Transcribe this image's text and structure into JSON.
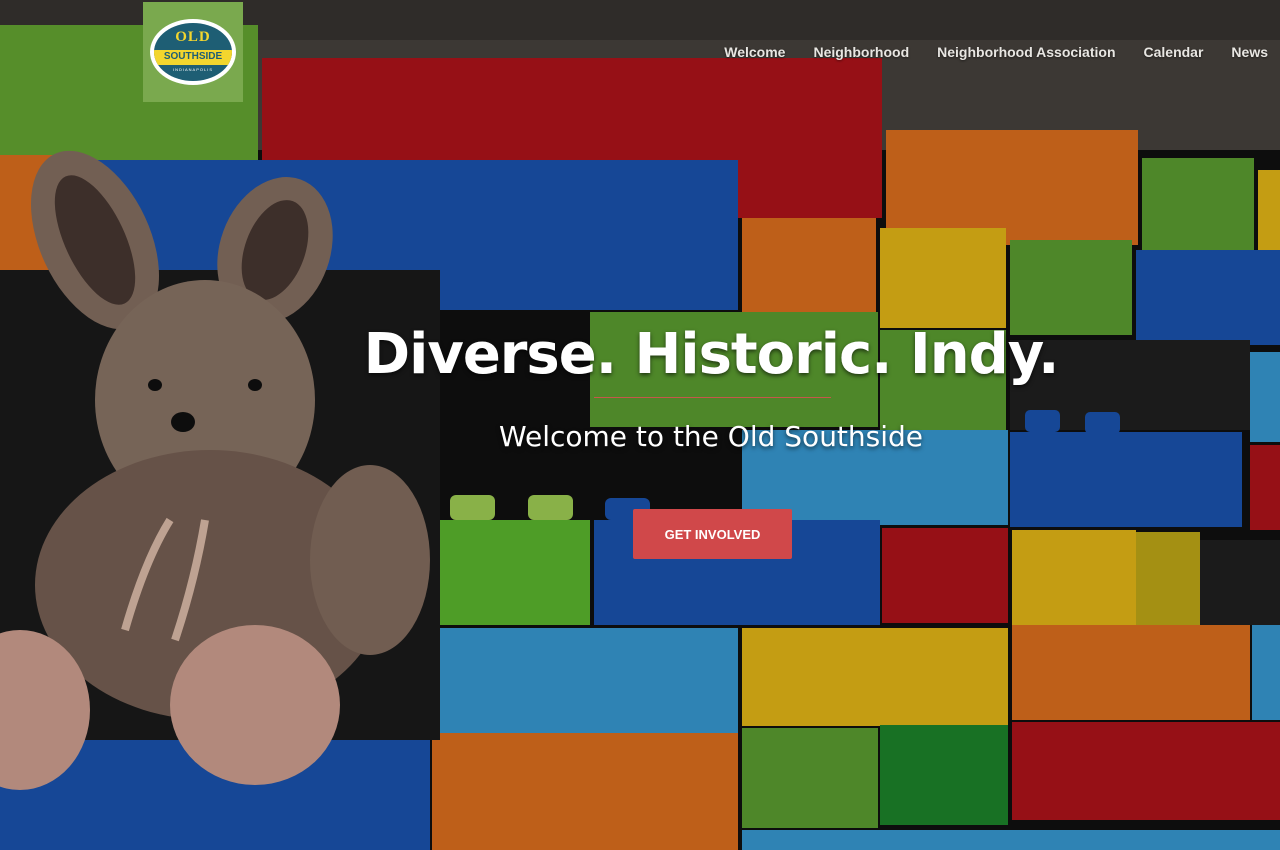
{
  "logo": {
    "name": "OLD SOUTHSIDE",
    "line1": "OLD",
    "line2": "SOUTHSIDE",
    "line3": "INDIANAPOLIS",
    "bg_color": "#7aa94e",
    "accent": "#f3d62e",
    "navy": "#1e5e74"
  },
  "nav": {
    "items": [
      {
        "label": "Welcome"
      },
      {
        "label": "Neighborhood"
      },
      {
        "label": "Neighborhood Association"
      },
      {
        "label": "Calendar"
      },
      {
        "label": "News"
      }
    ]
  },
  "hero": {
    "headline": "Diverse. Historic. Indy.",
    "subheadline": "Welcome to the Old Southside",
    "cta_label": "GET INVOLVED",
    "cta_color": "#d0484a",
    "background": "mural of colorful toy bricks with a stuffed bunny"
  }
}
